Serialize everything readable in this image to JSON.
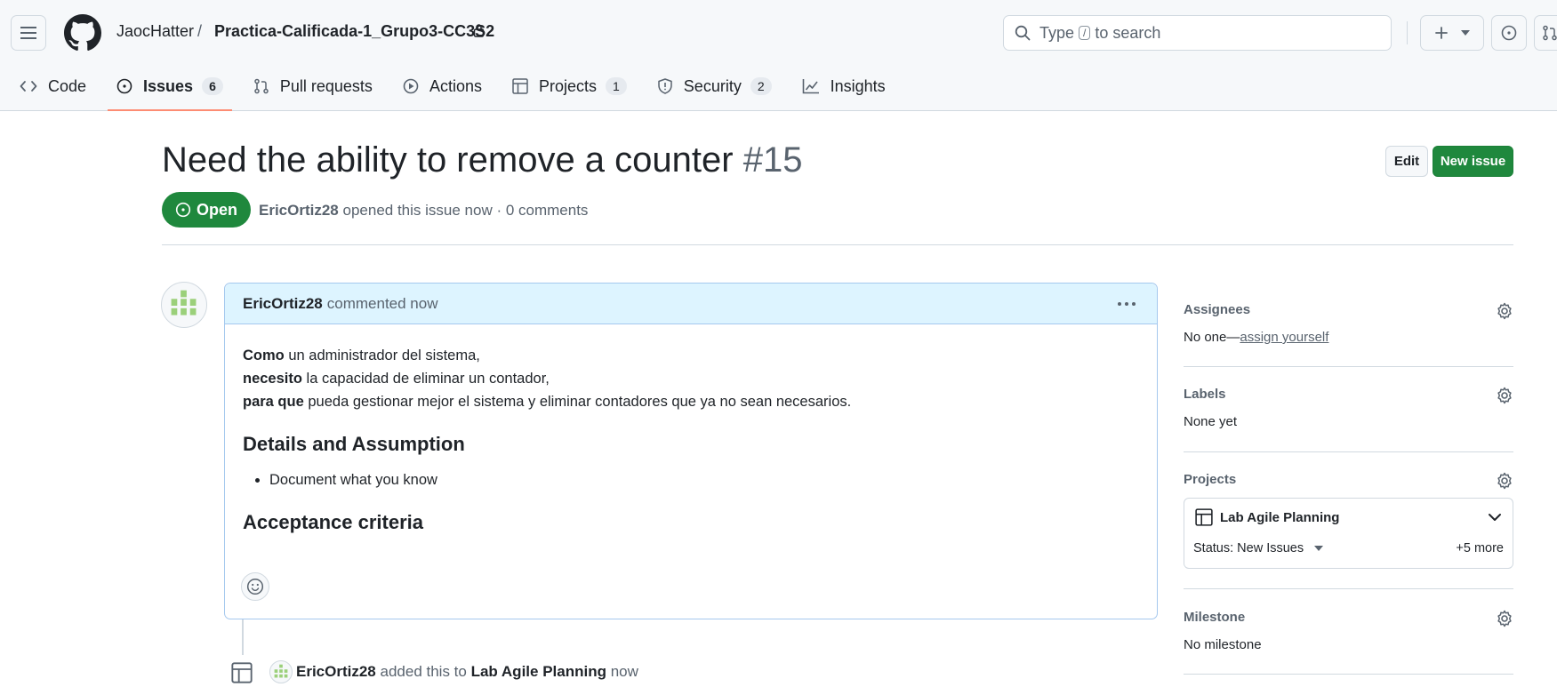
{
  "header": {
    "owner": "JaocHatter",
    "separator": "/",
    "repo": "Practica-Calificada-1_Grupo3-CC3S2",
    "search": {
      "prefix": "Type",
      "key": "/",
      "suffix": "to search"
    }
  },
  "tabs": [
    {
      "label": "Code",
      "icon": "code-icon"
    },
    {
      "label": "Issues",
      "count": "6",
      "icon": "issue-opened-icon",
      "active": true
    },
    {
      "label": "Pull requests",
      "icon": "git-pull-request-icon"
    },
    {
      "label": "Actions",
      "icon": "play-icon"
    },
    {
      "label": "Projects",
      "count": "1",
      "icon": "table-icon"
    },
    {
      "label": "Security",
      "count": "2",
      "icon": "shield-icon"
    },
    {
      "label": "Insights",
      "icon": "graph-icon"
    }
  ],
  "issue": {
    "title": "Need the ability to remove a counter",
    "number": "#15",
    "state": "Open",
    "author": "EricOrtiz28",
    "meta_rest": "opened this issue now · 0 comments",
    "edit_label": "Edit",
    "new_issue_label": "New issue"
  },
  "comment": {
    "author": "EricOrtiz28",
    "action": "commented now",
    "lines": [
      {
        "bold": "Como",
        "text": " un administrador del sistema,"
      },
      {
        "bold": "necesito",
        "text": " la capacidad de eliminar un contador,"
      },
      {
        "bold": "para que",
        "text": " pueda gestionar mejor el sistema y eliminar contadores que ya no sean necesarios."
      }
    ],
    "heading1": "Details and Assumption",
    "bullet1": "Document what you know",
    "heading2": "Acceptance criteria"
  },
  "event": {
    "author": "EricOrtiz28",
    "action": "added this to",
    "project": "Lab Agile Planning",
    "time": "now"
  },
  "sidebar": {
    "assignees": {
      "label": "Assignees",
      "value_prefix": "No one—",
      "value_link": "assign yourself"
    },
    "labels": {
      "label": "Labels",
      "value": "None yet"
    },
    "projects": {
      "label": "Projects",
      "project_name": "Lab Agile Planning",
      "status": "Status: New Issues",
      "more": "+5 more"
    },
    "milestone": {
      "label": "Milestone",
      "value": "No milestone"
    }
  },
  "colors": {
    "accent_green": "#1f883d",
    "tab_underline": "#fd8c73",
    "comment_header": "#ddf4ff"
  }
}
